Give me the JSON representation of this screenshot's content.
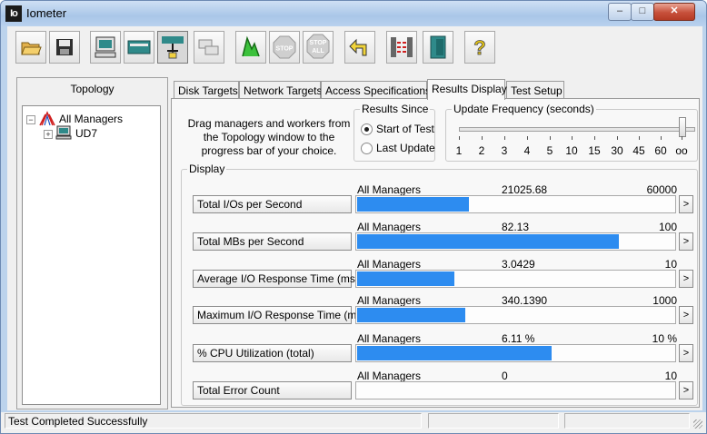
{
  "window": {
    "app_icon_text": "Io",
    "title": "Iometer",
    "min_glyph": "–",
    "max_glyph": "□",
    "close_glyph": "✕"
  },
  "toolbar": {
    "buttons": [
      {
        "name": "open-config-icon"
      },
      {
        "name": "save-config-icon"
      },
      {
        "name": "start-display-manager-icon"
      },
      {
        "name": "new-disk-worker-icon"
      },
      {
        "name": "new-network-worker-icon"
      },
      {
        "name": "duplicate-worker-icon"
      },
      {
        "name": "start-tests-icon"
      },
      {
        "name": "stop-icon",
        "label": "STOP"
      },
      {
        "name": "stop-all-icon",
        "label1": "STOP",
        "label2": "ALL"
      },
      {
        "name": "reset-workers-icon"
      },
      {
        "name": "disconnect-manager-icon"
      },
      {
        "name": "exit-icon"
      },
      {
        "name": "help-icon",
        "label": "?"
      }
    ]
  },
  "topology": {
    "title": "Topology",
    "root": {
      "expander": "−",
      "label": "All Managers"
    },
    "children": [
      {
        "expander": "+",
        "label": "UD7"
      }
    ]
  },
  "tabs": [
    {
      "label": "Disk Targets",
      "active": false
    },
    {
      "label": "Network Targets",
      "active": false
    },
    {
      "label": "Access Specifications",
      "active": false
    },
    {
      "label": "Results Display",
      "active": true
    },
    {
      "label": "Test Setup",
      "active": false
    }
  ],
  "results_display": {
    "instruction": "Drag managers and workers from the Topology window to the progress bar of your choice.",
    "results_since": {
      "title": "Results Since",
      "options": [
        {
          "label": "Start of Test",
          "selected": true
        },
        {
          "label": "Last Update",
          "selected": false
        }
      ]
    },
    "update_frequency": {
      "title": "Update Frequency (seconds)",
      "labels": [
        "1",
        "2",
        "3",
        "4",
        "5",
        "10",
        "15",
        "30",
        "45",
        "60",
        "oo"
      ],
      "selected": "oo",
      "selected_index": 10
    },
    "display": {
      "title": "Display",
      "more_glyph": ">",
      "metrics": [
        {
          "button": "Total I/Os per Second",
          "source": "All Managers",
          "value": "21025.68",
          "max": "60000",
          "fraction": 0.3504
        },
        {
          "button": "Total MBs per Second",
          "source": "All Managers",
          "value": "82.13",
          "max": "100",
          "fraction": 0.8213
        },
        {
          "button": "Average I/O Response Time (ms)",
          "source": "All Managers",
          "value": "3.0429",
          "max": "10",
          "fraction": 0.3043
        },
        {
          "button": "Maximum I/O Response Time (ms)",
          "source": "All Managers",
          "value": "340.1390",
          "max": "1000",
          "fraction": 0.3401
        },
        {
          "button": "% CPU Utilization (total)",
          "source": "All Managers",
          "value": "6.11 %",
          "max": "10 %",
          "fraction": 0.611
        },
        {
          "button": "Total Error Count",
          "source": "All Managers",
          "value": "0",
          "max": "10",
          "fraction": 0
        }
      ]
    }
  },
  "statusbar": {
    "text": "Test Completed Successfully"
  },
  "colors": {
    "bar_fill": "#2d8cf0",
    "title_bar": "#bcd3ec"
  }
}
